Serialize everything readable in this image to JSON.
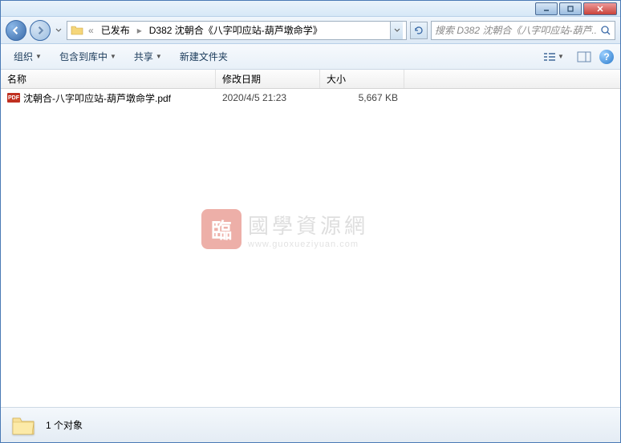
{
  "breadcrumb": {
    "ellipsis": "«",
    "items": [
      "已发布",
      "D382 沈朝合《八字叩应站-葫芦墩命学》"
    ]
  },
  "search": {
    "placeholder": "搜索 D382 沈朝合《八字叩应站-葫芦..."
  },
  "toolbar": {
    "organize": "组织",
    "include": "包含到库中",
    "share": "共享",
    "newfolder": "新建文件夹"
  },
  "columns": {
    "name": "名称",
    "date": "修改日期",
    "size": "大小"
  },
  "files": [
    {
      "icon": "PDF",
      "name": "沈朝合-八字叩应站-葫芦墩命学.pdf",
      "date": "2020/4/5 21:23",
      "size": "5,667 KB"
    }
  ],
  "watermark": {
    "logo": "臨",
    "main": "國學資源網",
    "sub": "www.guoxueziyuan.com"
  },
  "status": {
    "text": "1 个对象"
  }
}
